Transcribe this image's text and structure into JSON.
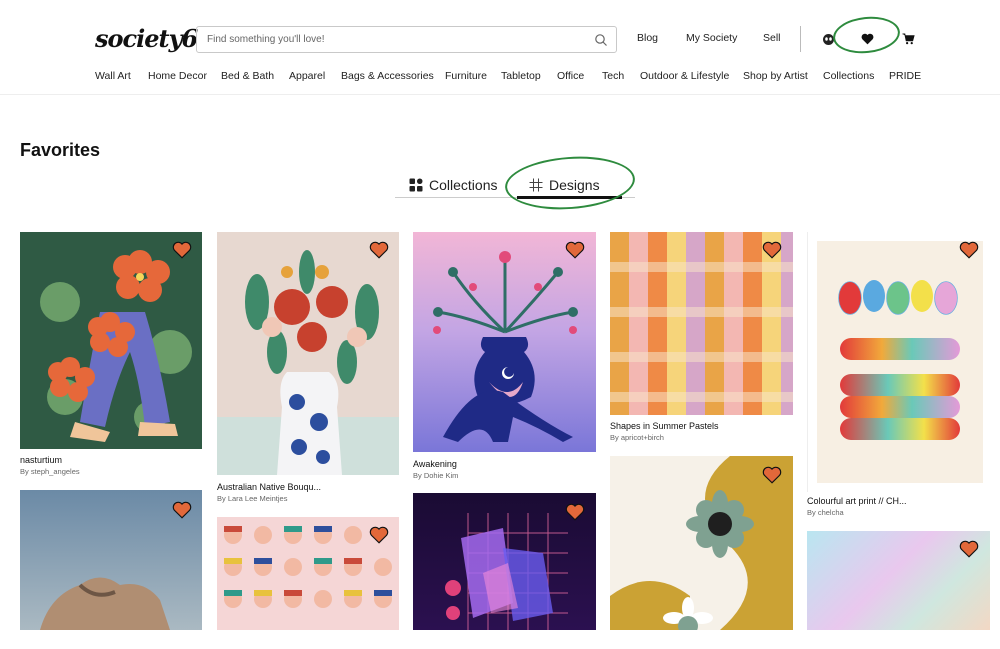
{
  "header": {
    "logo": "society6",
    "search_placeholder": "Find something you'll love!",
    "links": {
      "blog": "Blog",
      "my_society": "My Society",
      "sell": "Sell"
    }
  },
  "nav": [
    "Wall Art",
    "Home Decor",
    "Bed & Bath",
    "Apparel",
    "Bags & Accessories",
    "Furniture",
    "Tabletop",
    "Office",
    "Tech",
    "Outdoor & Lifestyle",
    "Shop by Artist",
    "Collections",
    "PRIDE"
  ],
  "page": {
    "title": "Favorites"
  },
  "tabs": [
    {
      "label": "Collections",
      "active": false
    },
    {
      "label": "Designs",
      "active": true
    }
  ],
  "products": [
    {
      "title": "nasturtium",
      "artist": "By steph_angeles"
    },
    {
      "title": "Australian Native Bouqu...",
      "artist": "By Lara Lee Meintjes"
    },
    {
      "title": "Awakening",
      "artist": "By Dohie Kim"
    },
    {
      "title": "Shapes in Summer Pastels",
      "artist": "By apricot+birch"
    },
    {
      "title": "Colourful art print // CH...",
      "artist": "By chelcha"
    }
  ],
  "colors": {
    "accent_heart": "#e2683a",
    "annotation_green": "#2e8b3e"
  }
}
